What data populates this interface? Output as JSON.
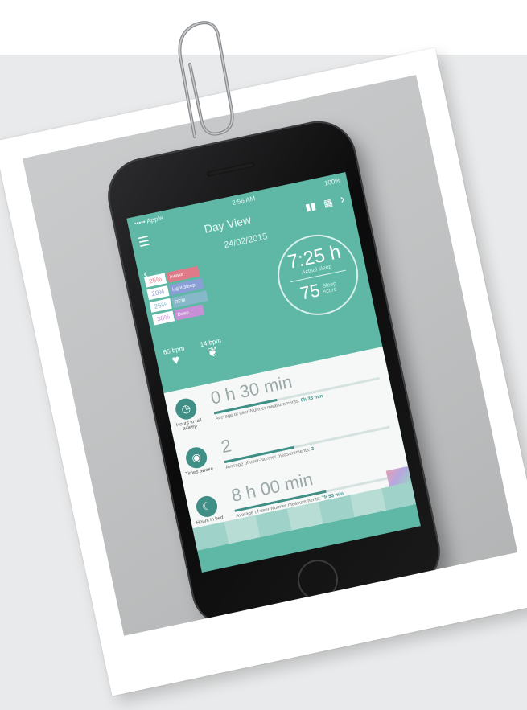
{
  "status_bar": {
    "carrier": "••••• Apple",
    "time": "2:56 AM",
    "battery": "100%"
  },
  "nav": {
    "title": "Day View",
    "menu_icon": "hamburger-icon",
    "chart_icon": "bar-chart-icon",
    "calendar_icon": "calendar-icon",
    "next": "›",
    "prev": "‹"
  },
  "date": "24/02/2015",
  "stages": [
    {
      "percent": "25%",
      "label": "Awake",
      "color": "#e07a88"
    },
    {
      "percent": "20%",
      "label": "Light sleep",
      "color": "#8b9fd6"
    },
    {
      "percent": "25%",
      "label": "REM",
      "color": "#86b8c9"
    },
    {
      "percent": "30%",
      "label": "Deep",
      "color": "#c88fd6"
    }
  ],
  "summary": {
    "actual_sleep_value": "7:25 h",
    "actual_sleep_label": "Actual sleep",
    "sleep_score_value": "75",
    "sleep_score_label": "Sleep score"
  },
  "vitals": {
    "heart_rate": "65 bpm",
    "breathing_rate": "14 bpm"
  },
  "metrics": [
    {
      "icon": "clock-icon",
      "label": "Hours to fall asleep",
      "value": "0 h 30 min",
      "average": "Average of user-Nurmer measurements:",
      "average_value": "0h 33 min",
      "fill": 0.38
    },
    {
      "icon": "eye-icon",
      "label": "Times awake",
      "value": "2",
      "average": "Average of user-Nurmer measurements:",
      "average_value": "3",
      "fill": 0.42
    },
    {
      "icon": "moon-icon",
      "label": "Hours in bed",
      "value": "8 h 00 min",
      "average": "Average of user-Nurmer measurements:",
      "average_value": "7h 53 min",
      "fill": 0.55
    }
  ]
}
